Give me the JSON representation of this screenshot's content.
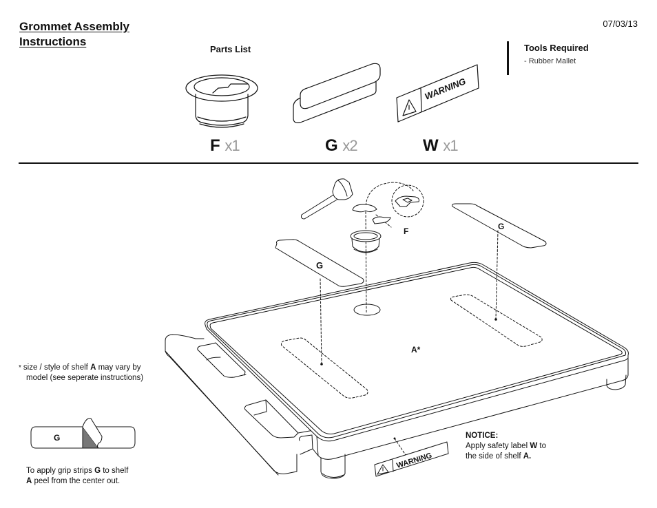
{
  "header": {
    "title_line1": "Grommet Assembly",
    "title_line2": "Instructions",
    "date": "07/03/13"
  },
  "parts_list": {
    "heading": "Parts List",
    "items": [
      {
        "letter": "F",
        "qty": "x1",
        "name": "grommet"
      },
      {
        "letter": "G",
        "qty": "x2",
        "name": "grip strip"
      },
      {
        "letter": "W",
        "qty": "x1",
        "name": "warning label",
        "label_text": "WARNING"
      }
    ]
  },
  "tools": {
    "heading": "Tools Required",
    "items": [
      "-  Rubber Mallet"
    ]
  },
  "diagram": {
    "labels": {
      "grommet": "F",
      "grip_left": "G",
      "grip_right": "G",
      "shelf": "A*",
      "warning": "WARNING"
    }
  },
  "notes": {
    "shelf_note": {
      "star": "*",
      "pre": "size / style of shelf ",
      "bold": "A",
      "post_line1": " may vary by",
      "line2": "model (see seperate instructions)"
    },
    "peel_strip_label": "G",
    "peel_note": {
      "pre": "To apply grip strips ",
      "bold1": "G",
      "mid": " to shelf",
      "bold2": "A",
      "post": " peel from the center out."
    },
    "notice": {
      "heading": "NOTICE:",
      "pre": "Apply safety label ",
      "bold1": "W",
      "mid": " to",
      "line2_pre": "the side of shelf ",
      "bold2": "A."
    }
  }
}
